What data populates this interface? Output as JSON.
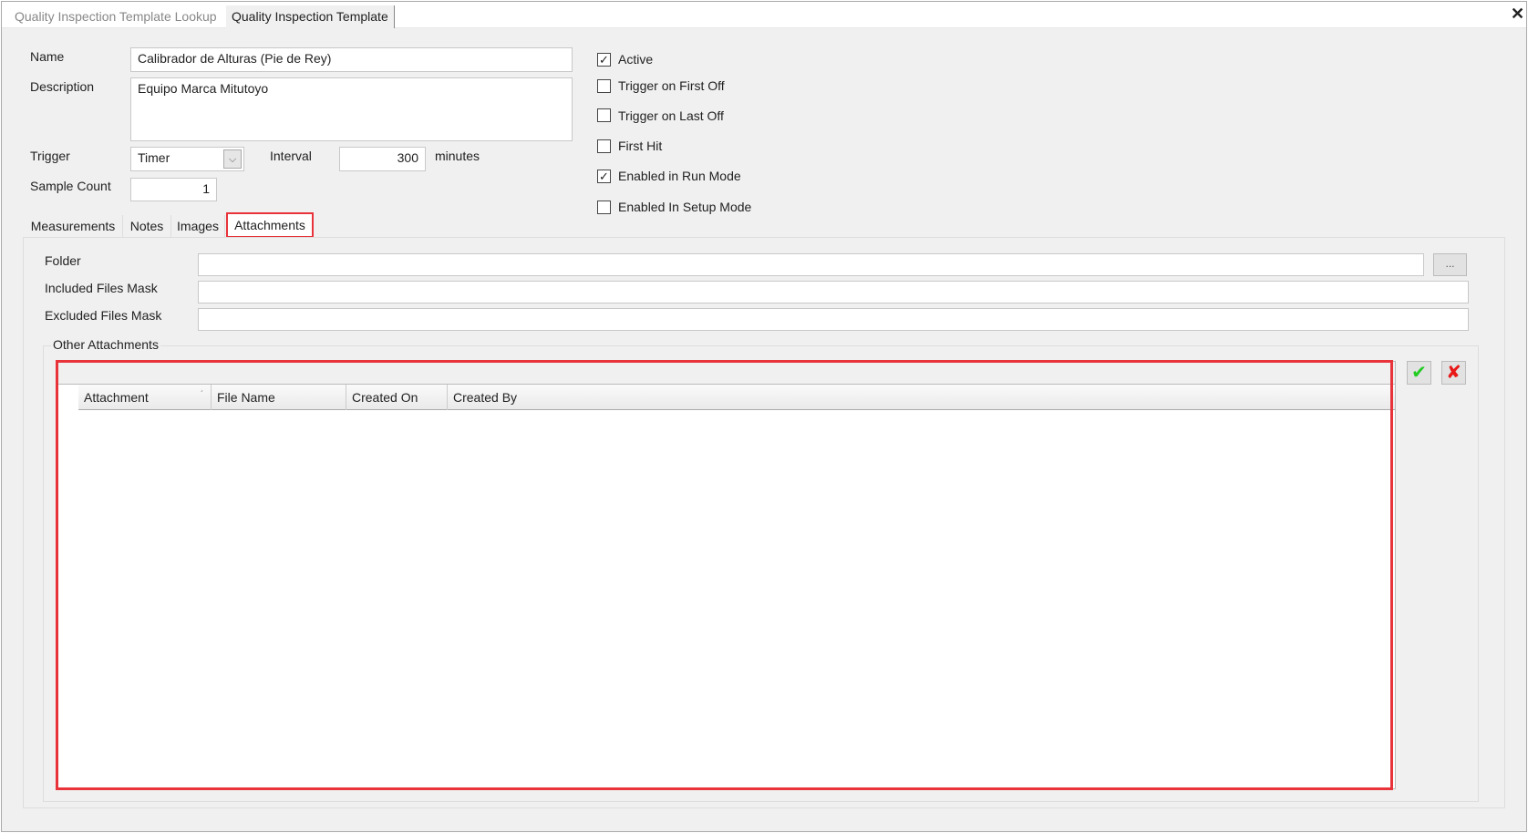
{
  "doc_tabs": [
    {
      "label": "Quality Inspection Template Lookup"
    },
    {
      "label": "Quality Inspection Template"
    }
  ],
  "form": {
    "name_label": "Name",
    "name_value": "Calibrador de Alturas (Pie de Rey)",
    "description_label": "Description",
    "description_value": "Equipo Marca Mitutoyo",
    "trigger_label": "Trigger",
    "trigger_value": "Timer",
    "interval_label": "Interval",
    "interval_value": "300",
    "interval_unit": "minutes",
    "sample_count_label": "Sample Count",
    "sample_count_value": "1"
  },
  "checkboxes": [
    {
      "label": "Active",
      "checked": true
    },
    {
      "label": "Trigger on First Off",
      "checked": false
    },
    {
      "label": "Trigger on Last Off",
      "checked": false
    },
    {
      "label": "First Hit",
      "checked": false
    },
    {
      "label": "Enabled in Run Mode",
      "checked": true
    },
    {
      "label": "Enabled In Setup Mode",
      "checked": false
    }
  ],
  "tabs": [
    {
      "label": "Measurements"
    },
    {
      "label": "Notes"
    },
    {
      "label": "Images"
    },
    {
      "label": "Attachments",
      "active": true
    }
  ],
  "attachments": {
    "folder_label": "Folder",
    "folder_value": "",
    "browse_label": "...",
    "included_label": "Included Files Mask",
    "included_value": "",
    "excluded_label": "Excluded Files Mask",
    "excluded_value": "",
    "group_label": "Other Attachments",
    "columns": [
      "Attachment",
      "File Name",
      "Created On",
      "Created By"
    ],
    "rows": []
  },
  "colors": {
    "highlight": "#e8333a",
    "accept": "#22cc22",
    "cancel": "#e81818"
  }
}
